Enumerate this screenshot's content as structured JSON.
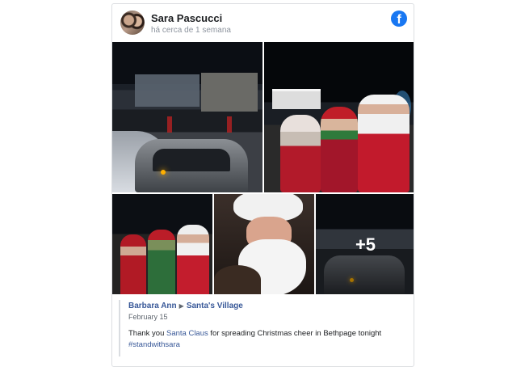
{
  "post": {
    "author": "Sara Pascucci",
    "time": "há cerca de 1 semana",
    "brand_icon": "facebook-icon",
    "brand_color": "#1877f2",
    "more_photos_label": "+5",
    "photos": [
      {
        "description": "Street with cars at night"
      },
      {
        "description": "Santa with elves and Mrs Claus"
      },
      {
        "description": "Santa and elves group"
      },
      {
        "description": "Santa close-up"
      },
      {
        "description": "Cars at night"
      }
    ]
  },
  "shared": {
    "author": "Barbara Ann",
    "page": "Santa's Village",
    "date": "February 15",
    "text_before": "Thank you ",
    "mention": "Santa Claus",
    "text_after": " for spreading Christmas cheer in Bethpage tonight",
    "hashtag": "#standwithsara"
  },
  "colors": {
    "link": "#385898",
    "text": "#1c1e21",
    "muted": "#8d949e"
  }
}
